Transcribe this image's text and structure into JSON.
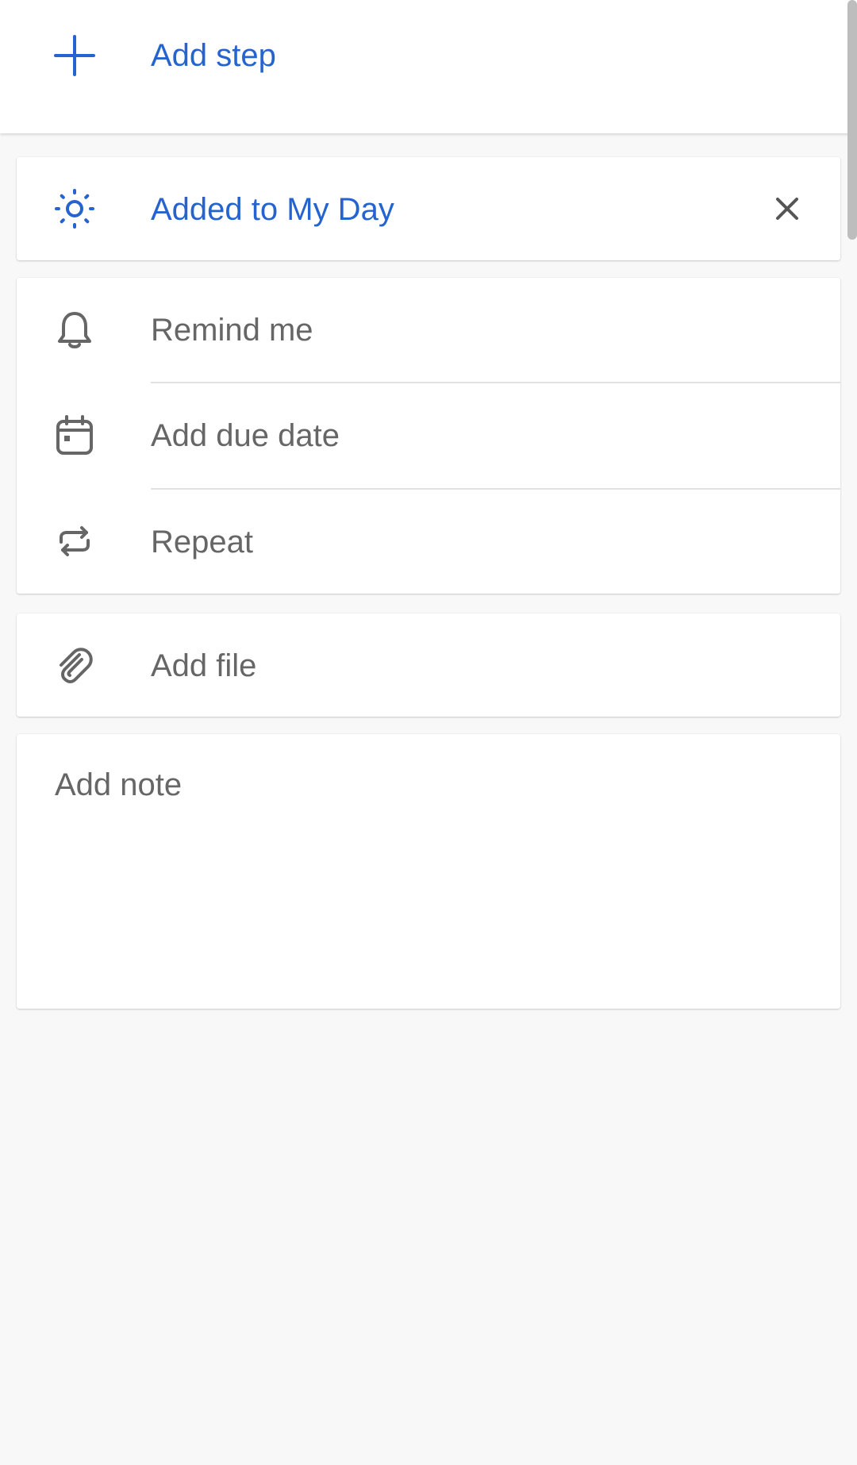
{
  "steps": {
    "add_label": "Add step"
  },
  "my_day": {
    "label": "Added to My Day",
    "remove_icon": "close-icon",
    "icon": "sun-icon"
  },
  "schedule": {
    "items": [
      {
        "label": "Remind me",
        "icon": "bell-icon"
      },
      {
        "label": "Add due date",
        "icon": "calendar-icon"
      },
      {
        "label": "Repeat",
        "icon": "repeat-icon"
      }
    ]
  },
  "attachments": {
    "label": "Add file",
    "icon": "paperclip-icon"
  },
  "note": {
    "placeholder": "Add note"
  },
  "colors": {
    "accent": "#2564cf",
    "text_muted": "#666666",
    "background": "#f8f8f8",
    "card": "#ffffff"
  }
}
